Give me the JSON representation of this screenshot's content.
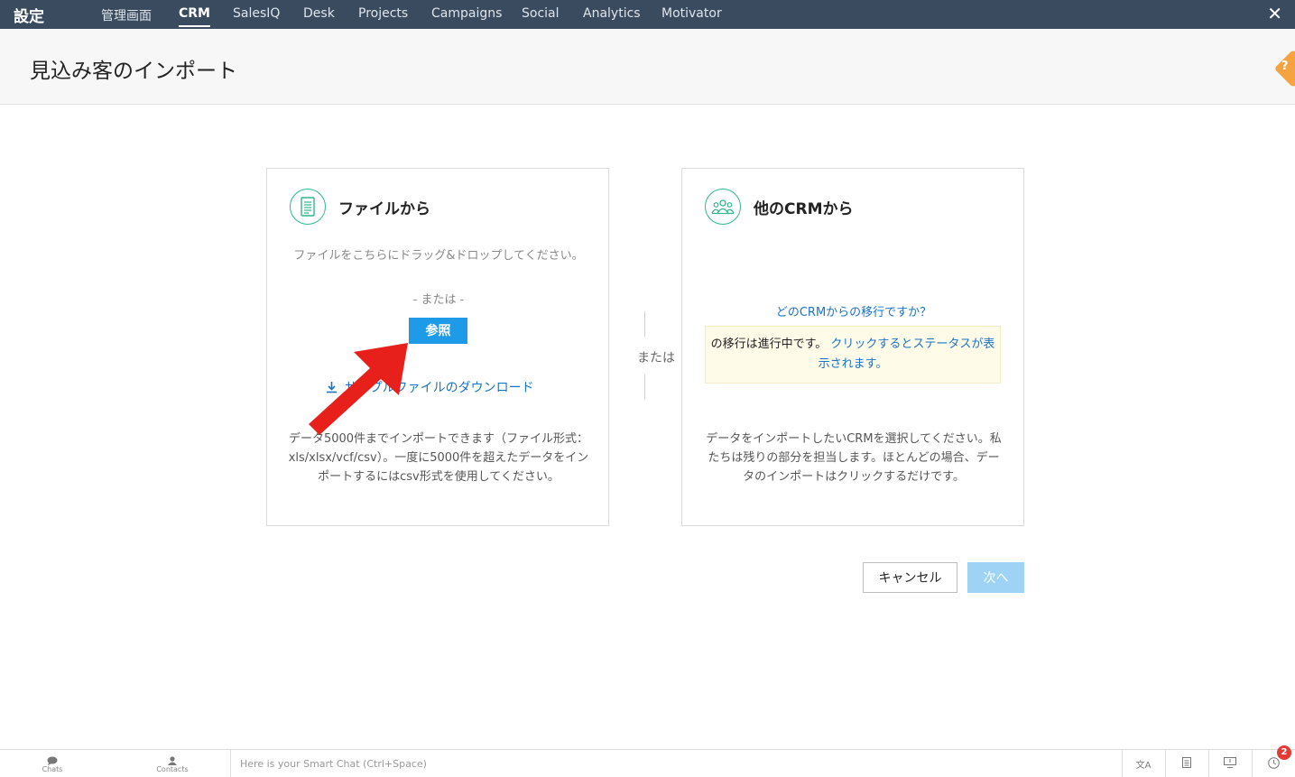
{
  "topbar": {
    "brand": "設定",
    "tabs": [
      "管理画面",
      "CRM",
      "SalesIQ",
      "Desk",
      "Projects",
      "Campaigns",
      "Social",
      "Analytics",
      "Motivator"
    ],
    "active_tab": "CRM"
  },
  "page": {
    "title": "見込み客のインポート"
  },
  "from_file": {
    "title": "ファイルから",
    "drag_text": "ファイルをこちらにドラッグ&ドロップしてください。",
    "or_text": "-  または  -",
    "browse_label": "参照",
    "download_link": "サンプルファイルのダウンロード",
    "footer_text": "データ5000件までインポートできます（ファイル形式：xls/xlsx/vcf/csv）。一度に5000件を超えたデータをインポートするにはcsv形式を使用してください。"
  },
  "divider": {
    "or_text": "または"
  },
  "from_crm": {
    "title": "他のCRMから",
    "which_crm_link": "どのCRMからの移行ですか？",
    "notice_text": "の移行は進行中です。",
    "notice_link": "クリックするとステータスが表示されます。",
    "footer_text": "データをインポートしたいCRMを選択してください。私たちは残りの部分を担当します。ほとんどの場合、データのインポートはクリックするだけです。"
  },
  "actions": {
    "cancel_label": "キャンセル",
    "next_label": "次へ"
  },
  "bottombar": {
    "chats_label": "Chats",
    "contacts_label": "Contacts",
    "smartchat_placeholder": "Here is your Smart Chat (Ctrl+Space)",
    "notification_count": "2"
  },
  "colors": {
    "topbar_bg": "#3a4b5f",
    "accent_green": "#2db88a",
    "link_blue": "#1a73c7",
    "primary_button": "#1e9be8",
    "next_button_disabled": "#9ed3f5",
    "annotation_arrow": "#e8201b",
    "help_tab": "#f5a340"
  }
}
